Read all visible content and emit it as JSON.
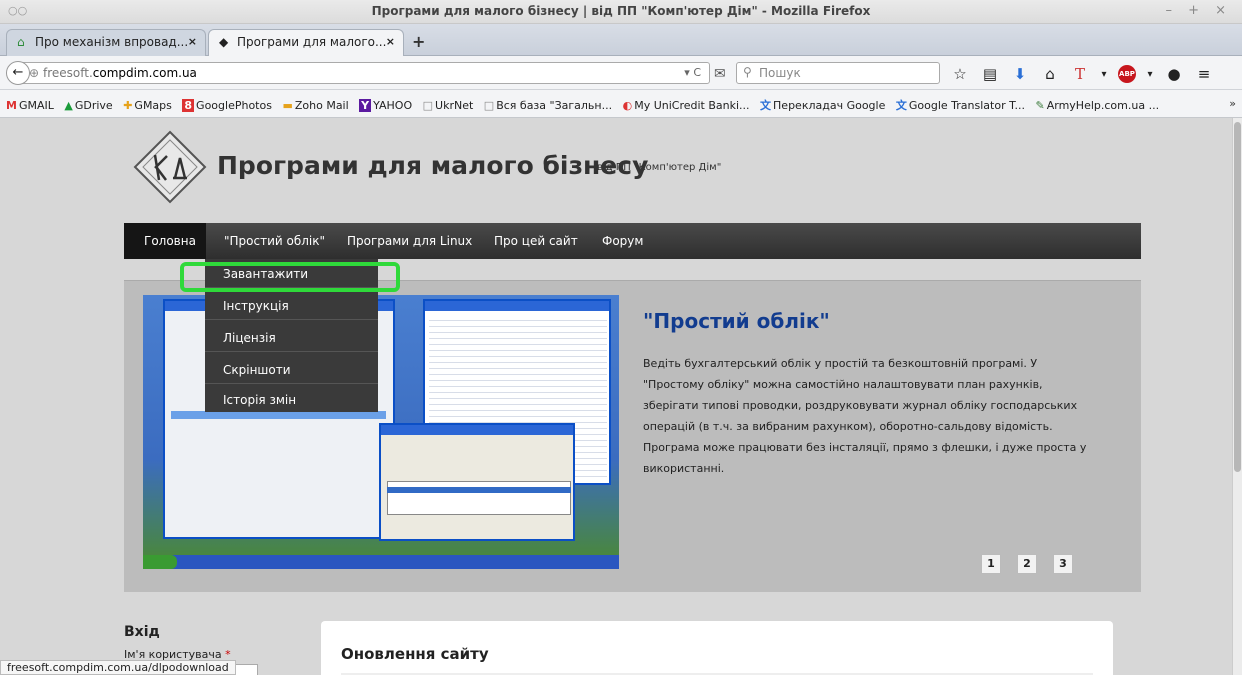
{
  "window": {
    "title": "Програми для малого бізнесу | від ПП \"Комп'ютер Дім\" - Mozilla Firefox",
    "controls": "– + ×"
  },
  "tabs": [
    {
      "label": "Про механізм впровад...",
      "close": "×"
    },
    {
      "label": "Програми для малого...",
      "close": "×"
    }
  ],
  "newtab": "+",
  "nav": {
    "url_prefix": "freesoft.",
    "url_main": "compdim.com.ua",
    "search_placeholder": "Пошук"
  },
  "bookmarks": [
    {
      "icon": "M",
      "label": "GMAIL"
    },
    {
      "icon": "▲",
      "label": "GDrive"
    },
    {
      "icon": "✚",
      "label": "GMaps"
    },
    {
      "icon": "8",
      "label": "GooglePhotos"
    },
    {
      "icon": "▬",
      "label": "Zoho Mail"
    },
    {
      "icon": "Y",
      "label": "YAHOO"
    },
    {
      "icon": "□",
      "label": "UkrNet"
    },
    {
      "icon": "□",
      "label": "Вся база \"Загальн..."
    },
    {
      "icon": "◐",
      "label": "My UniCredit Banki..."
    },
    {
      "icon": "文",
      "label": "Перекладач Google"
    },
    {
      "icon": "文",
      "label": "Google Translator T..."
    },
    {
      "icon": "✎",
      "label": "ArmyHelp.com.ua ..."
    }
  ],
  "bookmarks_more": "»",
  "site": {
    "title": "Програми для малого бізнесу",
    "subtitle": "від ПП \"Комп'ютер Дім\""
  },
  "menu": {
    "items": [
      "Головна",
      "\"Простий облік\"",
      "Програми для Linux",
      "Про цей сайт",
      "Форум"
    ],
    "dropdown": [
      "Завантажити",
      "Інструкція",
      "Ліцензія",
      "Скріншоти",
      "Історія змін"
    ]
  },
  "slide": {
    "title": "\"Простий облік\"",
    "text": "Ведіть бухгалтерський облік у простій та безкоштовній програмі. У \"Простому обліку\" можна самостійно налаштовувати план рахунків, зберігати типові проводки, роздруковувати журнал обліку господарських операцій (в т.ч. за вибраним рахунком), оборотно-сальдову відомість. Програма може працювати без інсталяції, прямо з флешки, і дуже проста у використанні.",
    "pages": [
      "1",
      "2",
      "3"
    ]
  },
  "login": {
    "heading": "Вхід",
    "username_label": "Ім'я користувача",
    "required_mark": "*"
  },
  "news": {
    "title": "Оновлення сайту"
  },
  "statusbar": "freesoft.compdim.com.ua/dlpodownload",
  "colors": {
    "highlight": "#2fd93a",
    "slide_title": "#123c8f",
    "menu_bg": "#3a3a3a"
  }
}
